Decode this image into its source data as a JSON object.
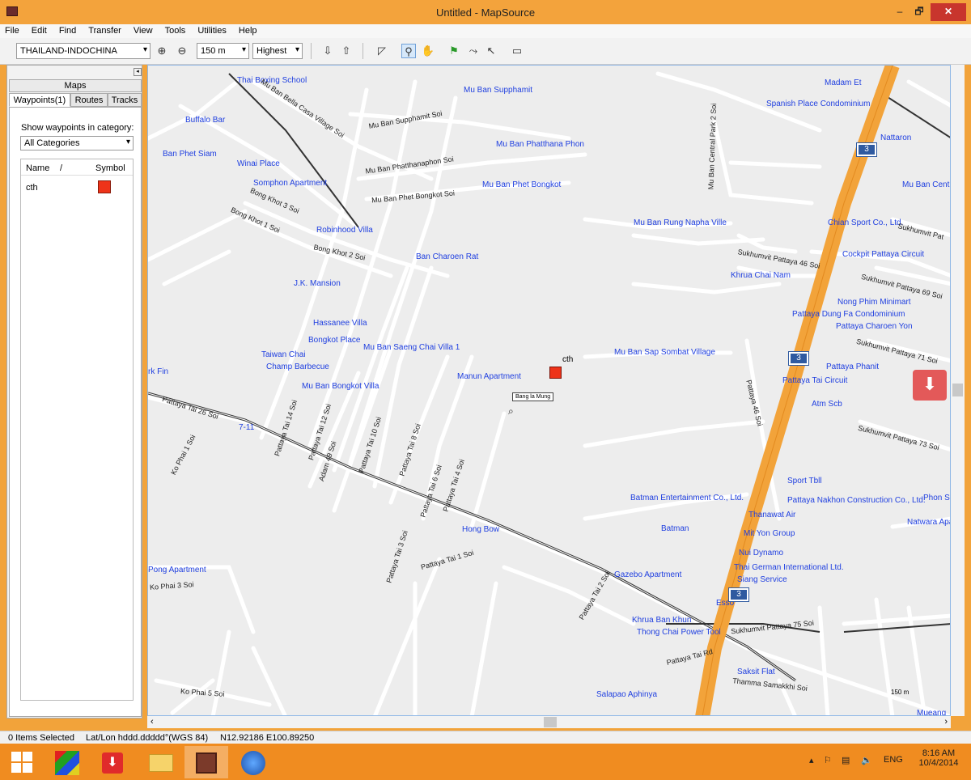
{
  "window": {
    "title": "Untitled - MapSource",
    "min_glyph": "–",
    "max_glyph": "🗗",
    "close_glyph": "✕"
  },
  "menu": [
    "File",
    "Edit",
    "Find",
    "Transfer",
    "View",
    "Tools",
    "Utilities",
    "Help"
  ],
  "toolbar": {
    "map_product": "THAILAND-INDOCHINA",
    "zoom_scale": "150 m",
    "detail_level": "Highest",
    "icons": [
      "zoom-in-icon",
      "zoom-out-icon",
      "receive-from-device-icon",
      "send-to-device-icon",
      "map-tool-icon",
      "zoom-tool-icon",
      "hand-tool-icon",
      "waypoint-tool-icon",
      "route-tool-icon",
      "selection-tool-icon",
      "distance-bearing-tool-icon"
    ]
  },
  "sidebar": {
    "tab_maps": "Maps",
    "tabs": [
      "Waypoints(1)",
      "Routes",
      "Tracks"
    ],
    "show_label": "Show waypoints in category:",
    "category_value": "All Categories",
    "columns": {
      "name": "Name",
      "sort_indicator": "/",
      "symbol": "Symbol"
    },
    "waypoints": [
      {
        "name": "cth",
        "symbol_color": "#ee3319"
      }
    ]
  },
  "map": {
    "waypoint_label": "cth",
    "cursor_tooltip": "Bang la Mung",
    "highway_shield": "3",
    "scale_label": "150 m",
    "poi_labels": [
      "Madam Et",
      "Spanish Place Condominium",
      "Mu Ban Supphamit",
      "Buffalo Bar",
      "Ban Phet Siam",
      "Winai Place",
      "Somphon Apartment",
      "Mu Ban Phatthana Phon",
      "Mu Ban Phet Bongkot",
      "Robinhood Villa",
      "Ban Charoen Rat",
      "Mu Ban Rung Napha Ville",
      "Khrua Chai Nam",
      "J.K. Mansion",
      "Hassanee Villa",
      "Bongkot Place",
      "Mu Ban Saeng Chai Villa 1",
      "Taiwan Chai",
      "Champ Barbecue",
      "Mu Ban Bongkot Villa",
      "Manun Apartment",
      "Mu Ban Sap Sombat Village",
      "Mu Ban Centr",
      "Chian Sport Co., Ltd.",
      "Cockpit Pattaya Circuit",
      "Nong Phim Minimart",
      "Pattaya Dung Fa Condominium",
      "Pattaya Charoen Yon",
      "Pattaya Phanit",
      "Pattaya Tai Circuit",
      "Atm Scb",
      "Sport Tbll",
      "Pattaya Nakhon Construction Co., Ltd.",
      "Phon S",
      "Batman Entertainment Co., Ltd.",
      "Thanawat Air",
      "Natwara Apa",
      "Batman",
      "Mit Yon Group",
      "Nui Dynamo",
      "Thai German International Ltd.",
      "Siang Service",
      "Esso",
      "Gazebo Apartment",
      "Khrua Ban Khun",
      "Thong Chai Power Tool",
      "Saksit Flat",
      "Salapao Aphinya",
      "Hong Bow",
      "Pong Apartment",
      "7-11",
      "rk Fin",
      "Mueang",
      "Thai Boxing School",
      "Nattaron"
    ],
    "road_labels": [
      "Mu Ban Bella Casa Village Soi",
      "Mu Ban Supphamit Soi",
      "Mu Ban Phatthanaphon Soi",
      "Mu Ban Phet Bongkot Soi",
      "Bong Khot 3 Soi",
      "Bong Khot 1 Soi",
      "Bong Khot 2 Soi",
      "Sukhumvit Pattaya 46 Soi",
      "Sukhumvit Pattaya 69 Soi",
      "Sukhumvit Pattaya 71 Soi",
      "Sukhumvit Pattaya 73 Soi",
      "Sukhumvit Pattaya 75 Soi",
      "Pattaya Tai 26 Soi",
      "Pattaya Tai 14 Soi",
      "Pattaya Tai 12 Soi",
      "Pattaya Tai 10 Soi",
      "Pattaya Tai 8 Soi",
      "Pattaya Tai 6 Soi",
      "Pattaya Tai 4 Soi",
      "Pattaya Tai 3 Soi",
      "Pattaya Tai 1 Soi",
      "Pattaya Tai 2 Soi",
      "Pattaya Tai Rd",
      "Ko Phai 1 Soi",
      "Ko Phai 3 Soi",
      "Ko Phai 5 Soi",
      "Adam 49 Soi",
      "Thamma Samakkhi Soi",
      "Mu Ban Central Park 2 Soi",
      "Pattaya 46 Soi",
      "Sukhumvit Pat"
    ]
  },
  "status": {
    "selection": "0 Items Selected",
    "coord_format": "Lat/Lon hddd.ddddd°(WGS 84)",
    "cursor_position": "N12.92186 E100.89250"
  },
  "taskbar": {
    "language": "ENG",
    "time": "8:16 AM",
    "date": "10/4/2014"
  }
}
